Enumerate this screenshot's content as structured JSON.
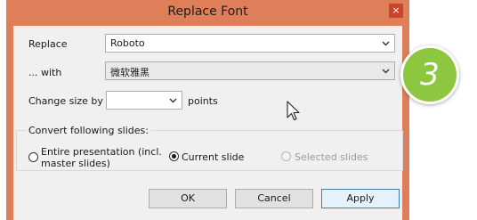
{
  "window": {
    "title": "Replace Font",
    "close_label": "×"
  },
  "replace": {
    "label": "Replace",
    "value": "Roboto"
  },
  "with": {
    "label": "... with",
    "value": "微软雅黑"
  },
  "size": {
    "label": "Change size by",
    "value": "",
    "unit_label": "points"
  },
  "convert": {
    "group_label": "Convert following slides:",
    "options": [
      {
        "label_line1": "Entire presentation (incl.",
        "label_line2": "master slides)",
        "checked": false,
        "enabled": true
      },
      {
        "label": "Current slide",
        "checked": true,
        "enabled": true
      },
      {
        "label": "Selected slides",
        "checked": false,
        "enabled": false
      }
    ]
  },
  "buttons": {
    "ok": "OK",
    "cancel": "Cancel",
    "apply": "Apply"
  },
  "step_badge": {
    "number": "3",
    "color": "#8dc63f"
  },
  "colors": {
    "title_bar": "#df7f5a",
    "close_button": "#c9452b",
    "dialog_bg": "#f0f0f0"
  }
}
